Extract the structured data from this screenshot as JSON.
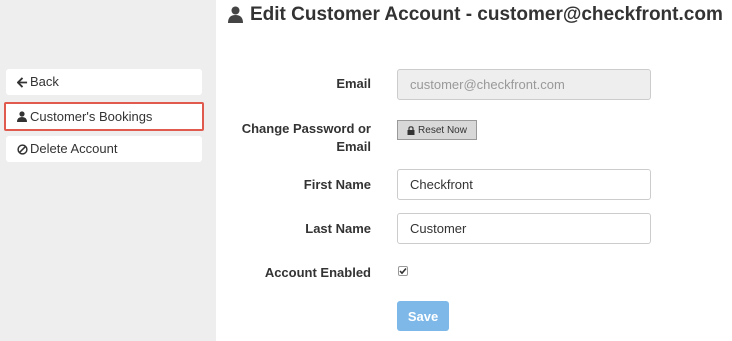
{
  "sidebar": {
    "items": [
      {
        "label": "Back",
        "icon": "arrow-left-icon"
      },
      {
        "label": "Customer's Bookings",
        "icon": "user-icon"
      },
      {
        "label": "Delete Account",
        "icon": "ban-icon"
      }
    ]
  },
  "header": {
    "title": "Edit Customer Account - customer@checkfront.com",
    "icon": "user-icon"
  },
  "form": {
    "email_label": "Email",
    "email_value": "customer@checkfront.com",
    "password_label": "Change Password or Email",
    "reset_label": "Reset Now",
    "first_name_label": "First Name",
    "first_name_value": "Checkfront",
    "last_name_label": "Last Name",
    "last_name_value": "Customer",
    "enabled_label": "Account Enabled",
    "enabled_checked": true,
    "save_label": "Save"
  },
  "colors": {
    "sidebar_bg": "#eeeeee",
    "highlight_border": "#e05a4e",
    "save_button": "#7db8e8"
  }
}
